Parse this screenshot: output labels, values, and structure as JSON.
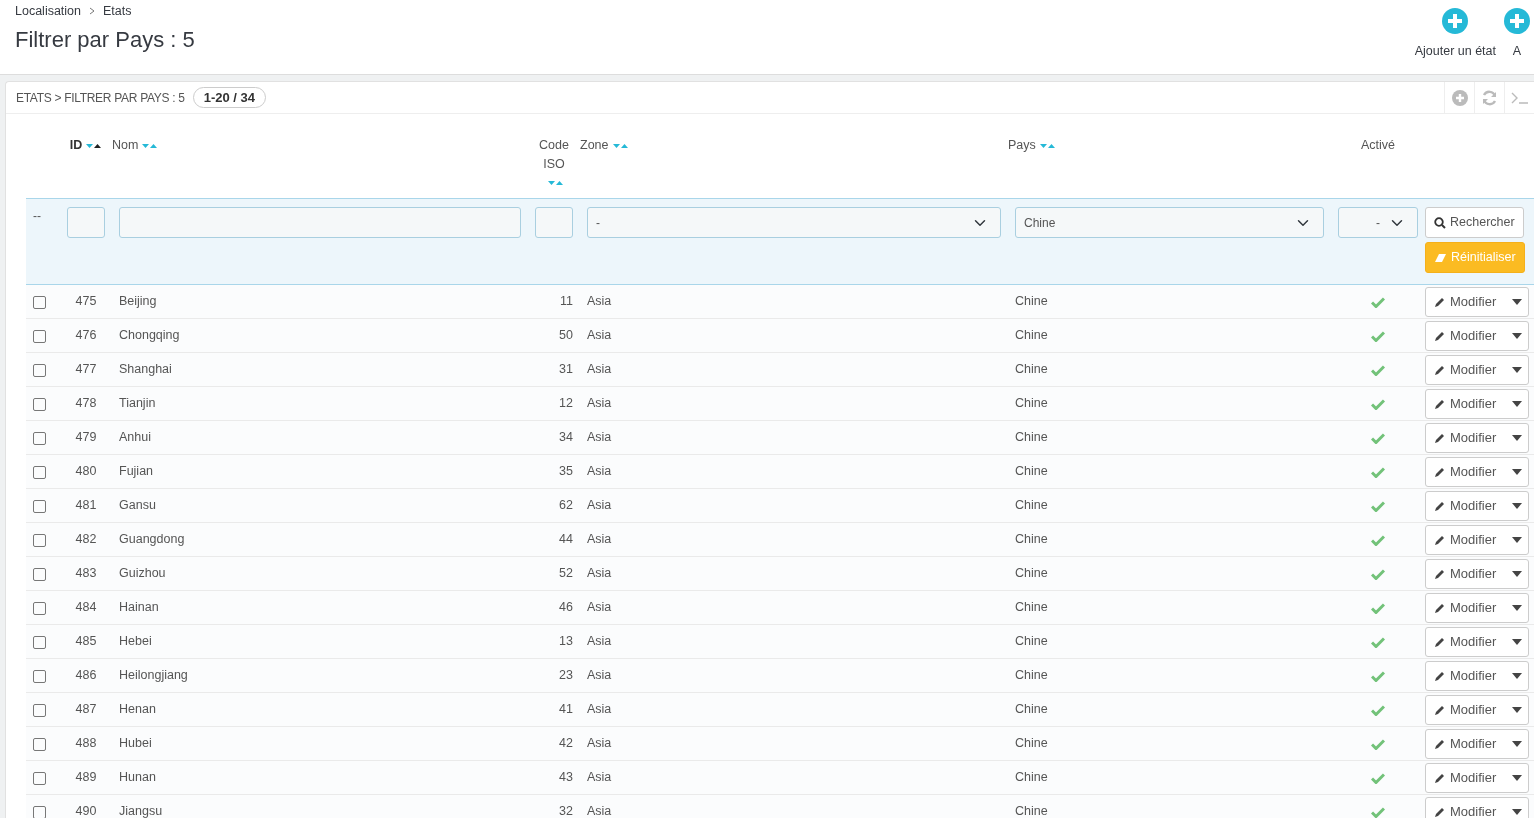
{
  "breadcrumb": [
    "Localisation",
    "Etats"
  ],
  "page_title": "Filtrer par Pays : 5",
  "toolbar": [
    {
      "label": "Ajouter un état"
    },
    {
      "label": "A"
    }
  ],
  "panel": {
    "title": "ETATS > FILTRER PAR PAYS : 5",
    "count": "1-20 / 34"
  },
  "columns": [
    {
      "label": "ID",
      "sortable": true,
      "sorted": true
    },
    {
      "label": "Nom",
      "sortable": true,
      "sorted": false
    },
    {
      "label": "Code ISO",
      "sortable": true,
      "sorted": false
    },
    {
      "label": "Zone",
      "sortable": true,
      "sorted": false
    },
    {
      "label": "Pays",
      "sortable": true,
      "sorted": false
    },
    {
      "label": "Activé",
      "sortable": false,
      "sorted": false
    }
  ],
  "filters": {
    "bulk": "--",
    "zone": "-",
    "country": "Chine",
    "active": "-",
    "search_button": "Rechercher",
    "reset_button": "Réinitialiser"
  },
  "rows": [
    {
      "id": "475",
      "name": "Beijing",
      "iso": "11",
      "zone": "Asia",
      "country": "Chine",
      "active": true,
      "checked": false,
      "action": "Modifier"
    },
    {
      "id": "476",
      "name": "Chongqing",
      "iso": "50",
      "zone": "Asia",
      "country": "Chine",
      "active": true,
      "checked": false,
      "action": "Modifier"
    },
    {
      "id": "477",
      "name": "Shanghai",
      "iso": "31",
      "zone": "Asia",
      "country": "Chine",
      "active": true,
      "checked": false,
      "action": "Modifier"
    },
    {
      "id": "478",
      "name": "Tianjin",
      "iso": "12",
      "zone": "Asia",
      "country": "Chine",
      "active": true,
      "checked": false,
      "action": "Modifier"
    },
    {
      "id": "479",
      "name": "Anhui",
      "iso": "34",
      "zone": "Asia",
      "country": "Chine",
      "active": true,
      "checked": false,
      "action": "Modifier"
    },
    {
      "id": "480",
      "name": "Fujian",
      "iso": "35",
      "zone": "Asia",
      "country": "Chine",
      "active": true,
      "checked": false,
      "action": "Modifier"
    },
    {
      "id": "481",
      "name": "Gansu",
      "iso": "62",
      "zone": "Asia",
      "country": "Chine",
      "active": true,
      "checked": false,
      "action": "Modifier"
    },
    {
      "id": "482",
      "name": "Guangdong",
      "iso": "44",
      "zone": "Asia",
      "country": "Chine",
      "active": true,
      "checked": false,
      "action": "Modifier"
    },
    {
      "id": "483",
      "name": "Guizhou",
      "iso": "52",
      "zone": "Asia",
      "country": "Chine",
      "active": true,
      "checked": false,
      "action": "Modifier"
    },
    {
      "id": "484",
      "name": "Hainan",
      "iso": "46",
      "zone": "Asia",
      "country": "Chine",
      "active": true,
      "checked": false,
      "action": "Modifier"
    },
    {
      "id": "485",
      "name": "Hebei",
      "iso": "13",
      "zone": "Asia",
      "country": "Chine",
      "active": true,
      "checked": false,
      "action": "Modifier"
    },
    {
      "id": "486",
      "name": "Heilongjiang",
      "iso": "23",
      "zone": "Asia",
      "country": "Chine",
      "active": true,
      "checked": false,
      "action": "Modifier"
    },
    {
      "id": "487",
      "name": "Henan",
      "iso": "41",
      "zone": "Asia",
      "country": "Chine",
      "active": true,
      "checked": false,
      "action": "Modifier"
    },
    {
      "id": "488",
      "name": "Hubei",
      "iso": "42",
      "zone": "Asia",
      "country": "Chine",
      "active": true,
      "checked": false,
      "action": "Modifier"
    },
    {
      "id": "489",
      "name": "Hunan",
      "iso": "43",
      "zone": "Asia",
      "country": "Chine",
      "active": true,
      "checked": false,
      "action": "Modifier"
    },
    {
      "id": "490",
      "name": "Jiangsu",
      "iso": "32",
      "zone": "Asia",
      "country": "Chine",
      "active": true,
      "checked": false,
      "action": "Modifier"
    }
  ]
}
